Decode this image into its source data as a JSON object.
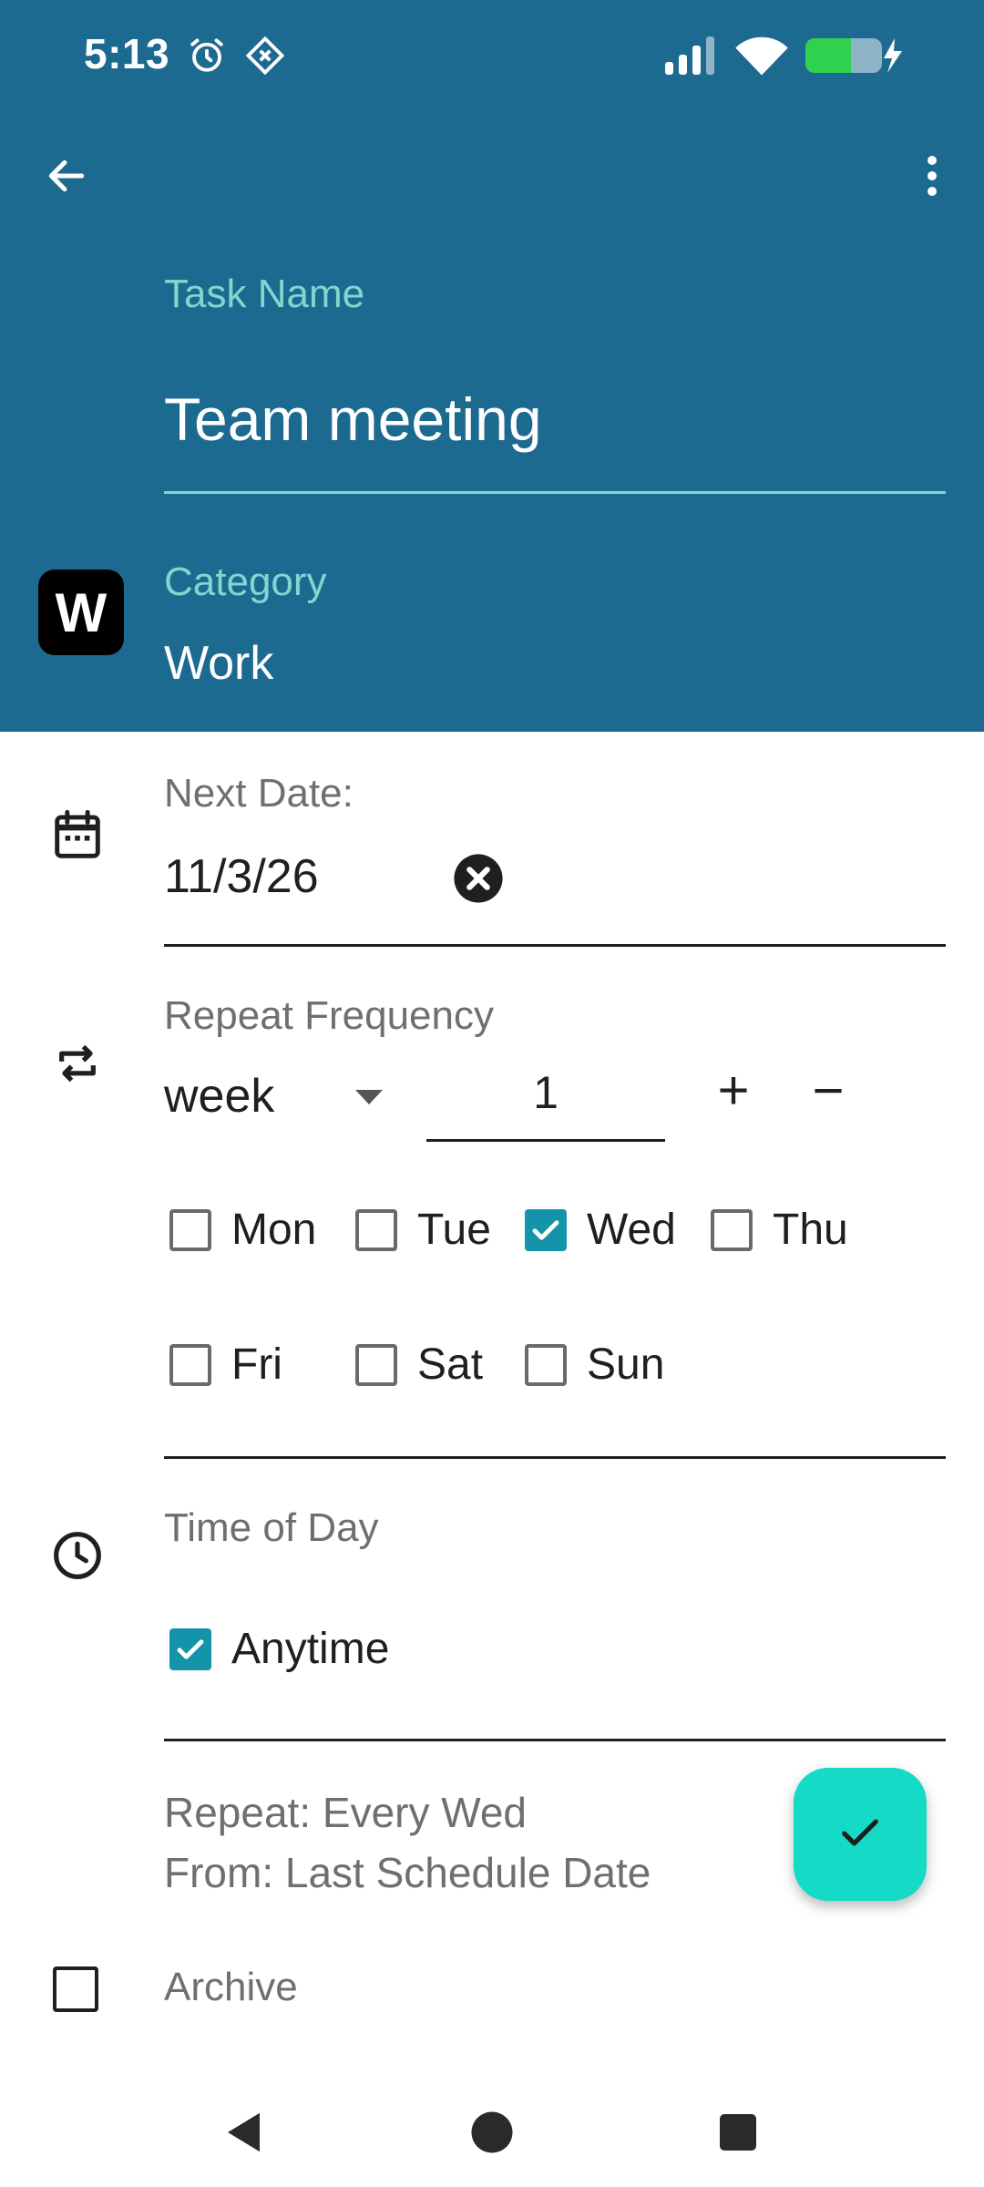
{
  "status_bar": {
    "time": "5:13",
    "icons": [
      "alarm-icon",
      "link-icon",
      "signal-icon",
      "wifi-icon",
      "battery-charging-icon"
    ]
  },
  "toolbar": {
    "back_icon": "arrow-left-icon",
    "menu_icon": "more-vertical-icon"
  },
  "task": {
    "label": "Task Name",
    "value": "Team meeting"
  },
  "category": {
    "label": "Category",
    "badge": "W",
    "value": "Work"
  },
  "next_date": {
    "label": "Next Date:",
    "value": "11/3/26"
  },
  "repeat": {
    "label": "Repeat Frequency",
    "unit": "week",
    "count": "1",
    "increment": "+",
    "decrement": "−",
    "days": [
      {
        "label": "Mon",
        "checked": false
      },
      {
        "label": "Tue",
        "checked": false
      },
      {
        "label": "Wed",
        "checked": true
      },
      {
        "label": "Thu",
        "checked": false
      },
      {
        "label": "Fri",
        "checked": false
      },
      {
        "label": "Sat",
        "checked": false
      },
      {
        "label": "Sun",
        "checked": false
      }
    ]
  },
  "time_of_day": {
    "label": "Time of Day",
    "anytime_label": "Anytime",
    "anytime_checked": true
  },
  "summary": {
    "line1": "Repeat: Every Wed",
    "line2": "From: Last Schedule Date"
  },
  "archive": {
    "label": "Archive",
    "checked": false
  },
  "colors": {
    "header_bg": "#1d6a91",
    "label_accent": "#7fd8cf",
    "checkbox_checked": "#1494aa",
    "fab_bg": "#15dac6"
  }
}
